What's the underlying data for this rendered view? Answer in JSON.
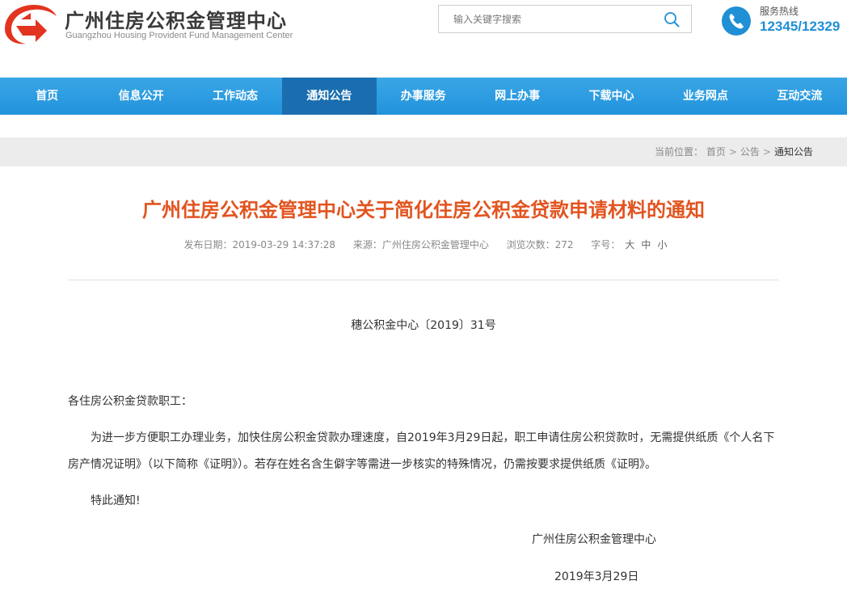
{
  "header": {
    "title": "广州住房公积金管理中心",
    "subtitle": "Guangzhou Housing Provident Fund Management Center",
    "search_placeholder": "输入关键字搜索",
    "hotline_label": "服务热线",
    "hotline_number": "12345/12329"
  },
  "nav": {
    "items": [
      "首页",
      "信息公开",
      "工作动态",
      "通知公告",
      "办事服务",
      "网上办事",
      "下载中心",
      "业务网点",
      "互动交流"
    ],
    "active_index": 3
  },
  "breadcrumb": {
    "prefix": "当前位置：",
    "items": [
      "首页",
      "公告",
      "通知公告"
    ],
    "separator": ">"
  },
  "article": {
    "title": "广州住房公积金管理中心关于简化住房公积金贷款申请材料的通知",
    "publish_date": "发布日期：2019-03-29 14:37:28",
    "source": "来源：广州住房公积金管理中心",
    "views": "浏览次数：272",
    "font_size_label": "字号：",
    "font_sizes": [
      "大",
      "中",
      "小"
    ],
    "doc_number": "穗公积金中心〔2019〕31号",
    "salutation": "各住房公积金贷款职工：",
    "body": "为进一步方便职工办理业务，加快住房公积金贷款办理速度，自2019年3月29日起，职工申请住房公积贷款时，无需提供纸质《个人名下房产情况证明》（以下简称《证明》）。若存在姓名含生僻字等需进一步核实的特殊情况，仍需按要求提供纸质《证明》。",
    "closing": "特此通知!",
    "signature_org": "广州住房公积金管理中心",
    "signature_date": "2019年3月29日"
  },
  "colors": {
    "brand_red": "#e2341f",
    "nav_blue": "#2293dc",
    "nav_active": "#1a6eaf",
    "title_orange": "#e2541f",
    "hotline_blue": "#1f8fd6"
  }
}
